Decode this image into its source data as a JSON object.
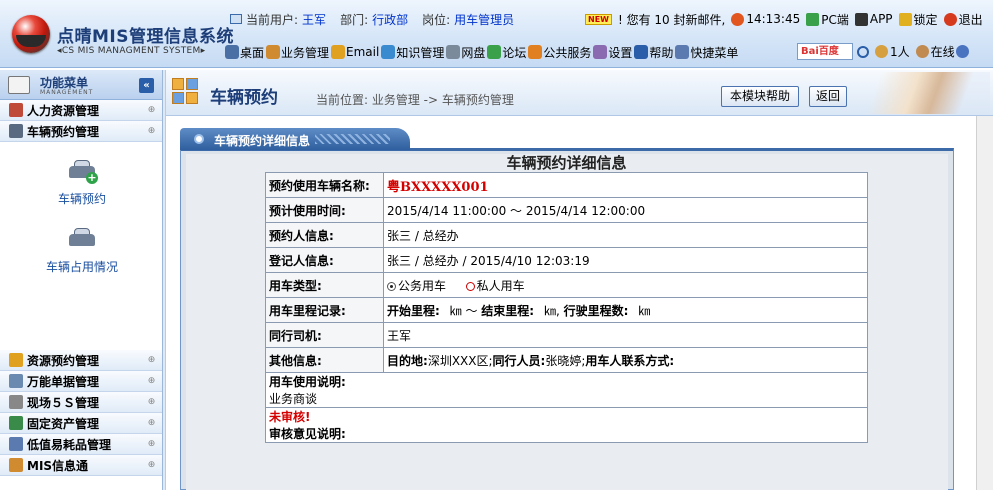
{
  "header": {
    "app_title": "点晴MIS管理信息系统",
    "app_subtitle": "◂CS MIS MANAGMENT SYSTEM▸",
    "current_user_label": "当前用户:",
    "current_user": "王军",
    "dept_label": "部门:",
    "dept": "行政部",
    "post_label": "岗位:",
    "post": "用车管理员",
    "new_badge": "NEW",
    "mail_notice": "! 您有 10 封新邮件,",
    "time": "14:13:45",
    "pc_label": "PC端",
    "app_label": "APP",
    "lock_label": "锁定",
    "exit_label": "退出",
    "online_users": "1人",
    "online_label": "在线",
    "search_logo": "Bai百度"
  },
  "menu": {
    "items": [
      {
        "label": "桌面",
        "icon": "desktop-icon",
        "color": "#4a6fa5"
      },
      {
        "label": "业务管理",
        "icon": "person-icon",
        "color": "#d08a30"
      },
      {
        "label": "Email",
        "icon": "email-icon",
        "color": "#e0a020"
      },
      {
        "label": "知识管理",
        "icon": "knowledge-icon",
        "color": "#3a8ad0"
      },
      {
        "label": "网盘",
        "icon": "disk-icon",
        "color": "#7a8a9a"
      },
      {
        "label": "论坛",
        "icon": "forum-icon",
        "color": "#3aa04a"
      },
      {
        "label": "公共服务",
        "icon": "service-icon",
        "color": "#e08020"
      },
      {
        "label": "设置",
        "icon": "settings-icon",
        "color": "#8a6ab0"
      },
      {
        "label": "帮助",
        "icon": "help-icon",
        "color": "#2a5ea8"
      },
      {
        "label": "快捷菜单",
        "icon": "shortcut-icon",
        "color": "#5a7ab0"
      }
    ]
  },
  "sidebar": {
    "title": "功能菜单",
    "subtitle": "MANAGEMENT",
    "collapse_symbol": "«",
    "expand_symbol": "⊕",
    "top_items": [
      {
        "label": "人力资源管理",
        "color": "#c04a3a"
      },
      {
        "label": "车辆预约管理",
        "color": "#5a6a80"
      }
    ],
    "sub_links": [
      {
        "label": "车辆预约"
      },
      {
        "label": "车辆占用情况"
      }
    ],
    "bottom_items": [
      {
        "label": "资源预约管理",
        "color": "#e0a020"
      },
      {
        "label": "万能单据管理",
        "color": "#6a8ab0"
      },
      {
        "label": "现场５Ｓ管理",
        "color": "#888888"
      },
      {
        "label": "固定资产管理",
        "color": "#3a8a4a"
      },
      {
        "label": "低值易耗品管理",
        "color": "#5a7ab0"
      },
      {
        "label": "MIS信息通",
        "color": "#d08a30"
      }
    ]
  },
  "page": {
    "title": "车辆预约",
    "breadcrumb": "当前位置: 业务管理 -> 车辆预约管理",
    "help_button": "本模块帮助",
    "back_button": "返回",
    "panel_tab": "车辆预约详细信息"
  },
  "detail": {
    "heading": "车辆预约详细信息",
    "plate_label": "预约使用车辆名称:",
    "plate": "粤BXXXXX001",
    "time_label": "预计使用时间:",
    "time": "2015/4/14 11:00:00 ～ 2015/4/14 12:00:00",
    "booker_label": "预约人信息:",
    "booker": "张三 / 总经办",
    "registrar_label": "登记人信息:",
    "registrar": "张三 / 总经办 / 2015/4/10 12:03:19",
    "type_label": "用车类型:",
    "type_option1": "公务用车",
    "type_option2": "私人用车",
    "mileage_label": "用车里程记录:",
    "mileage_start_label": "开始里程:",
    "mileage_unit1": "㎞ ～",
    "mileage_end_label": "结束里程:",
    "mileage_unit2": "㎞,",
    "mileage_total_label": "行驶里程数:",
    "mileage_unit3": "㎞",
    "driver_label": "同行司机:",
    "driver": "王军",
    "other_label": "其他信息:",
    "dest_label": "目的地:",
    "dest": "深圳XXX区;",
    "companions_label": "同行人员:",
    "companions": "张晓婷;",
    "contact_label": "用车人联系方式:",
    "usage_label": "用车使用说明:",
    "usage": "业务商谈",
    "review_status": "未审核!",
    "review_label": "审核意见说明:"
  }
}
